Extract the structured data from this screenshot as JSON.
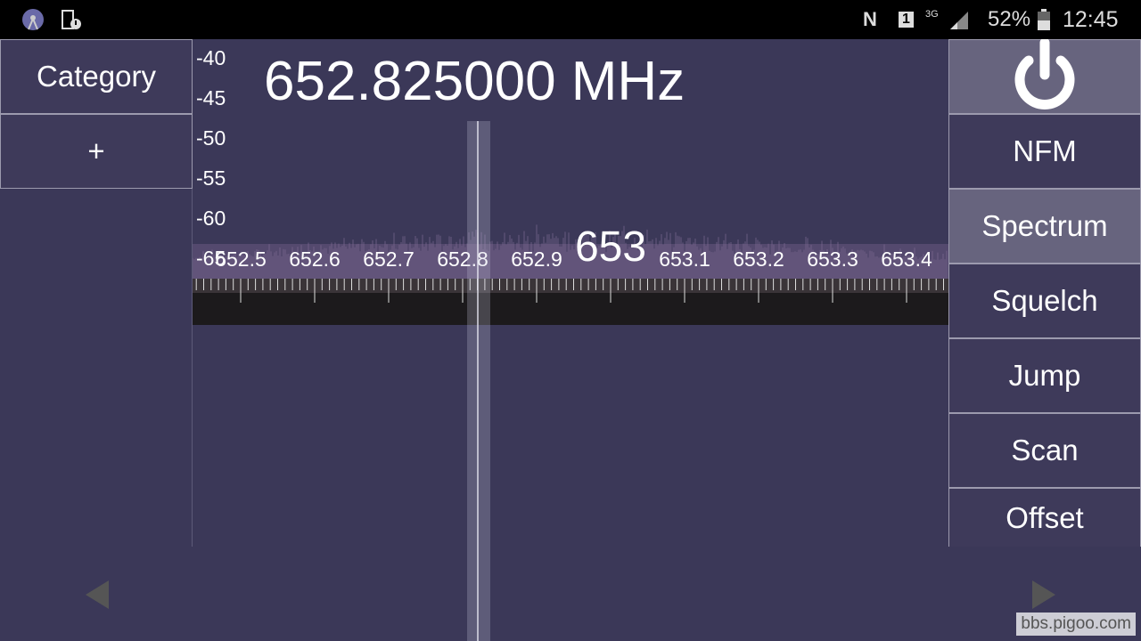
{
  "status_bar": {
    "battery": "52%",
    "time": "12:45",
    "network": "3G",
    "sim": "1",
    "left_icons": [
      "radio-tower-icon",
      "phone-alert-icon"
    ],
    "right_icons": [
      "nfc-icon",
      "sim-icon",
      "signal-icon",
      "battery-icon"
    ]
  },
  "frequency": "652.825000 MHz",
  "left_panel": {
    "category_label": "Category",
    "add_label": "+"
  },
  "right_panel": {
    "power_icon": "power-icon",
    "items": [
      {
        "label": "NFM",
        "active": false
      },
      {
        "label": "Spectrum",
        "active": true
      },
      {
        "label": "Squelch",
        "active": false
      },
      {
        "label": "Jump",
        "active": false
      },
      {
        "label": "Scan",
        "active": false
      },
      {
        "label": "Offset",
        "active": false
      }
    ]
  },
  "db_scale": [
    "-40",
    "-45",
    "-50",
    "-55",
    "-60",
    "-65"
  ],
  "freq_axis": {
    "labels": [
      "652.5",
      "652.6",
      "652.7",
      "652.8",
      "652.9",
      "653",
      "653.1",
      "653.2",
      "653.3",
      "653.4"
    ],
    "highlighted": "653"
  },
  "watermark": "bbs.pigoo.com",
  "colors": {
    "background": "#3b3858",
    "button": "#3e3a5a",
    "button_active": "#67647e",
    "spectrum": "#7a6a90"
  }
}
